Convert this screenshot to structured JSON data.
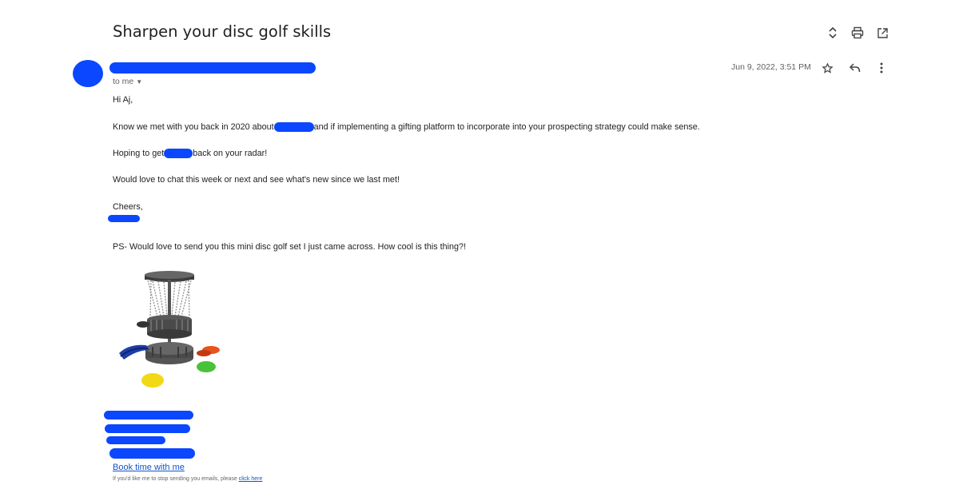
{
  "email": {
    "subject": "Sharpen your disc golf skills",
    "recipient_label": "to me",
    "date": "Jun 9, 2022, 3:51 PM",
    "greeting": "Hi Aj,",
    "para1_before": "Know we met with you back in 2020 about",
    "para1_after": "and if implementing a gifting platform to incorporate into your prospecting strategy could make sense.",
    "para2_before": "Hoping to get",
    "para2_after": "back on your radar!",
    "para3": "Would love to chat this week or next and see what's new since we last met!",
    "signoff": "Cheers,",
    "ps": "PS- Would love to send you this mini disc golf set I just came across. How cool is this thing?!",
    "book_link": "Book time with me",
    "unsubscribe_text": "If you'd like me to stop sending you emails, please",
    "unsubscribe_link": "click here"
  },
  "icons": {
    "expand": "unfold-icon",
    "print": "print-icon",
    "open_new": "open-in-new-icon",
    "star": "star-icon",
    "reply": "reply-icon",
    "more": "more-vert-icon"
  },
  "colors": {
    "redaction": "#0a47ff",
    "link": "#1155cc"
  }
}
